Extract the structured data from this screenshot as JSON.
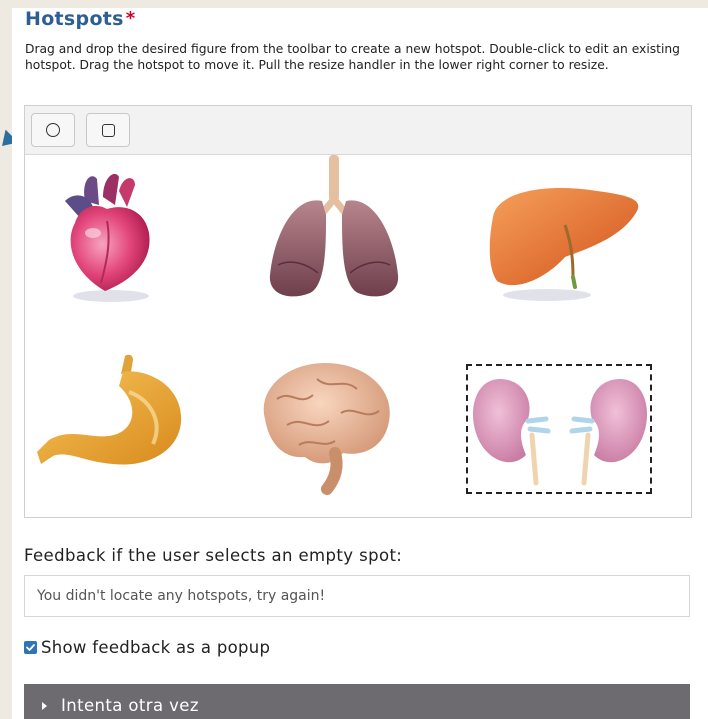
{
  "section": {
    "title": "Hotspots",
    "required_mark": "*",
    "instructions": "Drag and drop the desired figure from the toolbar to create a new hotspot. Double-click to edit an existing hotspot. Drag the hotspot to move it. Pull the resize handler in the lower right corner to resize."
  },
  "toolbar": {
    "tools": [
      {
        "icon": "circle-icon"
      },
      {
        "icon": "square-icon"
      }
    ]
  },
  "image": {
    "organs": [
      "heart",
      "lungs",
      "liver",
      "stomach",
      "brain",
      "kidneys"
    ]
  },
  "feedback": {
    "label": "Feedback if the user selects an empty spot:",
    "value": "You didn't locate any hotspots, try again!",
    "popup_label": "Show feedback as a popup",
    "popup_checked": true
  },
  "retry": {
    "label": "Intenta otra vez"
  },
  "colors": {
    "title": "#2d5f93",
    "required": "#d0021b",
    "checkbox": "#2f74b5",
    "retry_bar": "#6d6a70"
  }
}
